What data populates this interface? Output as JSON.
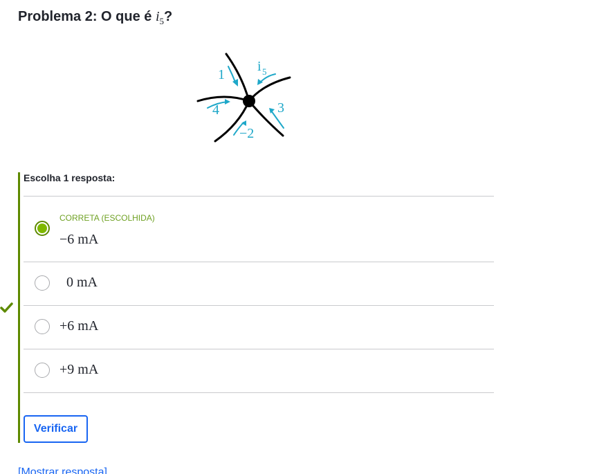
{
  "problem": {
    "title_prefix": "Problema 2: O que é ",
    "title_var": "i",
    "title_sub": "5",
    "title_suffix": "?"
  },
  "diagram": {
    "labels": {
      "current_1": "1",
      "current_5_base": "i",
      "current_5_sub": "5",
      "current_3": "3",
      "current_4": "4",
      "current_neg2": "−2"
    },
    "wire_color": "#000000",
    "arrow_color": "#1fa8c9"
  },
  "answer": {
    "prompt": "Escolha 1 resposta:",
    "choices": [
      {
        "status": "CORRETA (ESCOLHIDA)",
        "value": "−6 mA",
        "selected": true
      },
      {
        "status": "",
        "value": "  0 mA",
        "selected": false
      },
      {
        "status": "",
        "value": "+6 mA",
        "selected": false
      },
      {
        "status": "",
        "value": "+9 mA",
        "selected": false
      }
    ]
  },
  "actions": {
    "verify_label": "Verificar",
    "show_answer_label": "[Mostrar resposta]"
  },
  "colors": {
    "correct": "#5e8a00",
    "correct_light": "#7fb800",
    "primary": "#1865f2"
  }
}
